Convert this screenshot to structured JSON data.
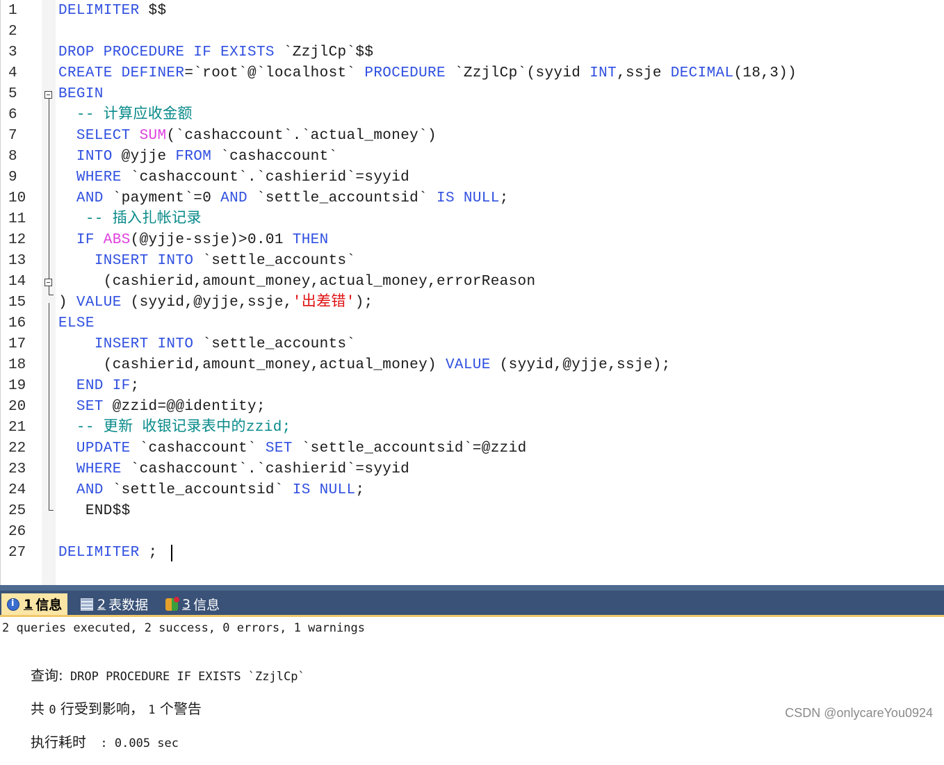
{
  "editor": {
    "line_numbers": [
      "1",
      "2",
      "3",
      "4",
      "5",
      "6",
      "7",
      "8",
      "9",
      "10",
      "11",
      "12",
      "13",
      "14",
      "15",
      "16",
      "17",
      "18",
      "19",
      "20",
      "21",
      "22",
      "23",
      "24",
      "25",
      "26",
      "27"
    ],
    "lines": [
      [
        {
          "t": "DELIMITER",
          "c": "kw"
        },
        {
          "t": " $$",
          "c": "tx"
        }
      ],
      [],
      [
        {
          "t": "DROP PROCEDURE IF EXISTS",
          "c": "kw"
        },
        {
          "t": " `ZzjlCp`$$",
          "c": "tx"
        }
      ],
      [
        {
          "t": "CREATE DEFINER",
          "c": "kw"
        },
        {
          "t": "=`root`@`localhost` ",
          "c": "tx"
        },
        {
          "t": "PROCEDURE",
          "c": "kw"
        },
        {
          "t": " `ZzjlCp`(syyid ",
          "c": "tx"
        },
        {
          "t": "INT",
          "c": "kw"
        },
        {
          "t": ",ssje ",
          "c": "tx"
        },
        {
          "t": "DECIMAL",
          "c": "kw"
        },
        {
          "t": "(18,3))",
          "c": "tx"
        }
      ],
      [
        {
          "t": "BEGIN",
          "c": "kw"
        }
      ],
      [
        {
          "t": "  -- 计算应收金额",
          "c": "cm"
        }
      ],
      [
        {
          "t": "  ",
          "c": "tx"
        },
        {
          "t": "SELECT",
          "c": "kw"
        },
        {
          "t": " ",
          "c": "tx"
        },
        {
          "t": "SUM",
          "c": "fn"
        },
        {
          "t": "(`cashaccount`.`actual_money`)",
          "c": "tx"
        }
      ],
      [
        {
          "t": "  ",
          "c": "tx"
        },
        {
          "t": "INTO",
          "c": "kw"
        },
        {
          "t": " @yjje ",
          "c": "tx"
        },
        {
          "t": "FROM",
          "c": "kw"
        },
        {
          "t": " `cashaccount`",
          "c": "tx"
        }
      ],
      [
        {
          "t": "  ",
          "c": "tx"
        },
        {
          "t": "WHERE",
          "c": "kw"
        },
        {
          "t": " `cashaccount`.`cashierid`=syyid",
          "c": "tx"
        }
      ],
      [
        {
          "t": "  ",
          "c": "tx"
        },
        {
          "t": "AND",
          "c": "kw"
        },
        {
          "t": " `payment`=0 ",
          "c": "tx"
        },
        {
          "t": "AND",
          "c": "kw"
        },
        {
          "t": " `settle_accountsid` ",
          "c": "tx"
        },
        {
          "t": "IS NULL",
          "c": "kw"
        },
        {
          "t": ";",
          "c": "tx"
        }
      ],
      [
        {
          "t": "   -- 插入扎帐记录",
          "c": "cm"
        }
      ],
      [
        {
          "t": "  ",
          "c": "tx"
        },
        {
          "t": "IF",
          "c": "kw"
        },
        {
          "t": " ",
          "c": "tx"
        },
        {
          "t": "ABS",
          "c": "fn"
        },
        {
          "t": "(@yjje-ssje)>0.01 ",
          "c": "tx"
        },
        {
          "t": "THEN",
          "c": "kw"
        }
      ],
      [
        {
          "t": "    ",
          "c": "tx"
        },
        {
          "t": "INSERT INTO",
          "c": "kw"
        },
        {
          "t": " `settle_accounts`",
          "c": "tx"
        }
      ],
      [
        {
          "t": "     (cashierid,amount_money,actual_money,errorReason",
          "c": "tx"
        }
      ],
      [
        {
          "t": ") ",
          "c": "tx"
        },
        {
          "t": "VALUE",
          "c": "kw"
        },
        {
          "t": " (syyid,@yjje,ssje,",
          "c": "tx"
        },
        {
          "t": "'出差错'",
          "c": "str"
        },
        {
          "t": ");",
          "c": "tx"
        }
      ],
      [
        {
          "t": "ELSE",
          "c": "kw"
        }
      ],
      [
        {
          "t": "    ",
          "c": "tx"
        },
        {
          "t": "INSERT INTO",
          "c": "kw"
        },
        {
          "t": " `settle_accounts`",
          "c": "tx"
        }
      ],
      [
        {
          "t": "     (cashierid,amount_money,actual_money) ",
          "c": "tx"
        },
        {
          "t": "VALUE",
          "c": "kw"
        },
        {
          "t": " (syyid,@yjje,ssje);",
          "c": "tx"
        }
      ],
      [
        {
          "t": "  ",
          "c": "tx"
        },
        {
          "t": "END IF",
          "c": "kw"
        },
        {
          "t": ";",
          "c": "tx"
        }
      ],
      [
        {
          "t": "  ",
          "c": "tx"
        },
        {
          "t": "SET",
          "c": "kw"
        },
        {
          "t": " @zzid=@@identity;",
          "c": "tx"
        }
      ],
      [
        {
          "t": "  -- 更新 收银记录表中的zzid;",
          "c": "cm"
        }
      ],
      [
        {
          "t": "  ",
          "c": "tx"
        },
        {
          "t": "UPDATE",
          "c": "kw"
        },
        {
          "t": " `cashaccount` ",
          "c": "tx"
        },
        {
          "t": "SET",
          "c": "kw"
        },
        {
          "t": " `settle_accountsid`=@zzid",
          "c": "tx"
        }
      ],
      [
        {
          "t": "  ",
          "c": "tx"
        },
        {
          "t": "WHERE",
          "c": "kw"
        },
        {
          "t": " `cashaccount`.`cashierid`=syyid",
          "c": "tx"
        }
      ],
      [
        {
          "t": "  ",
          "c": "tx"
        },
        {
          "t": "AND",
          "c": "kw"
        },
        {
          "t": " `settle_accountsid` ",
          "c": "tx"
        },
        {
          "t": "IS NULL",
          "c": "kw"
        },
        {
          "t": ";",
          "c": "tx"
        }
      ],
      [
        {
          "t": "   END$$",
          "c": "tx"
        }
      ],
      [],
      [
        {
          "t": "DELIMITER",
          "c": "kw"
        },
        {
          "t": " ;",
          "c": "tx"
        }
      ]
    ]
  },
  "result_panel": {
    "tabs": [
      {
        "num": "1",
        "label": "信息",
        "icon": "info-icon",
        "active": true
      },
      {
        "num": "2",
        "label": "表数据",
        "icon": "table-icon",
        "active": false
      },
      {
        "num": "3",
        "label": "信息",
        "icon": "messages-icon",
        "active": false
      }
    ],
    "summary": "2 queries executed, 2 success, 0 errors, 1 warnings",
    "query_label": "查询:",
    "query_text": " DROP PROCEDURE IF EXISTS `ZzjlCp`",
    "affected_line_a": "共 ",
    "affected_count": "0",
    "affected_line_b": " 行受到影响， ",
    "warning_count": "1",
    "affected_line_c": " 个警告",
    "exec_label": "执行耗时",
    "exec_value": "  : 0.005 sec"
  },
  "watermark": "CSDN @onlycareYou0924",
  "colors": {
    "keyword": "#3050e0",
    "function": "#e040e0",
    "comment": "#0a8a8a",
    "string": "#e01010",
    "tab_active": "#fbe6a6",
    "tab_strip": "#3a5277"
  }
}
